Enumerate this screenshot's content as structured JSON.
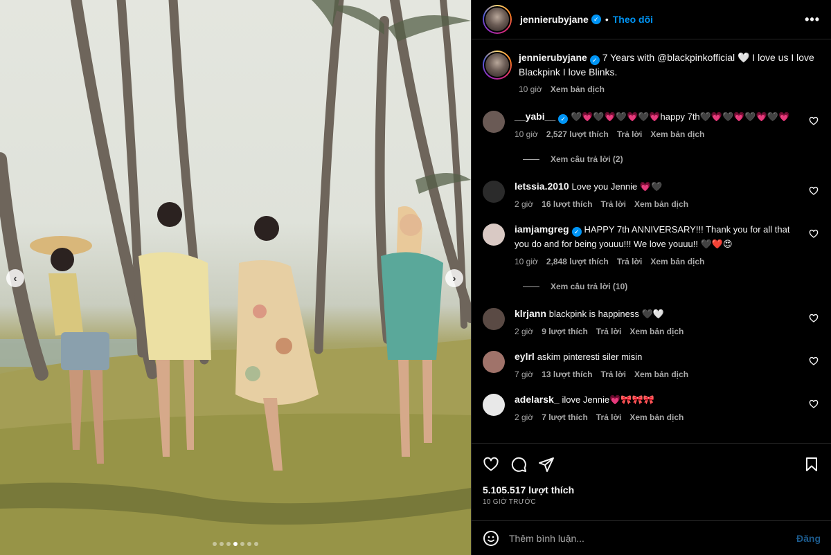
{
  "header": {
    "username": "jennierubyjane",
    "separator": "•",
    "follow_label": "Theo dõi",
    "more": "•••"
  },
  "photo": {
    "prev": "‹",
    "next": "›",
    "slide_count": 7,
    "active_slide": 4
  },
  "caption": {
    "username": "jennierubyjane",
    "text": "7 Years with @blackpinkofficial 🤍 I love us I love Blackpink I love Blinks.",
    "time": "10 giờ",
    "translate": "Xem bản dịch"
  },
  "comments": [
    {
      "username": "__yabi__",
      "verified": true,
      "text": "🖤💗🖤💗🖤💗🖤💗happy 7th🖤💗🖤💗🖤💗🖤💗",
      "time": "10 giờ",
      "likes": "2,527 lượt thích",
      "reply": "Trả lời",
      "translate": "Xem bản dịch",
      "replies": "Xem câu trả lời (2)",
      "avatar_color": "#6a5a55"
    },
    {
      "username": "letssia.2010",
      "verified": false,
      "text": "Love you Jennie 💗🖤",
      "time": "2 giờ",
      "likes": "16 lượt thích",
      "reply": "Trả lời",
      "translate": "Xem bản dịch",
      "avatar_color": "#2b2b2b"
    },
    {
      "username": "iamjamgreg",
      "verified": true,
      "text": "HAPPY 7th ANNIVERSARY!!! Thank you for all that you do and for being youuu!!! We love youuu!! 🖤❤️😍",
      "time": "10 giờ",
      "likes": "2,848 lượt thích",
      "reply": "Trả lời",
      "translate": "Xem bản dịch",
      "replies": "Xem câu trả lời (10)",
      "avatar_color": "#d9c9c4"
    },
    {
      "username": "klrjann",
      "verified": false,
      "text": "blackpink is happiness 🖤🤍",
      "time": "2 giờ",
      "likes": "9 lượt thích",
      "reply": "Trả lời",
      "translate": "Xem bản dịch",
      "avatar_color": "#5a4a44"
    },
    {
      "username": "eylrl",
      "verified": false,
      "text": "askim pinteresti siler misin",
      "time": "7 giờ",
      "likes": "13 lượt thích",
      "reply": "Trả lời",
      "translate": "Xem bản dịch",
      "avatar_color": "#a0736a"
    },
    {
      "username": "adelarsk_",
      "verified": false,
      "text": "ilove Jennie💗🎀🎀🎀",
      "time": "2 giờ",
      "likes": "7 lượt thích",
      "reply": "Trả lời",
      "translate": "Xem bản dịch",
      "avatar_color": "#e8e8e8"
    }
  ],
  "actions": {
    "likes_count": "5.105.517 lượt thích",
    "post_time": "10 GIỜ TRƯỚC"
  },
  "add_comment": {
    "placeholder": "Thêm bình luận...",
    "post_label": "Đăng"
  },
  "icons": {
    "like": "heart-icon",
    "comment": "comment-icon",
    "share": "share-icon",
    "save": "bookmark-icon",
    "emoji": "emoji-icon"
  }
}
